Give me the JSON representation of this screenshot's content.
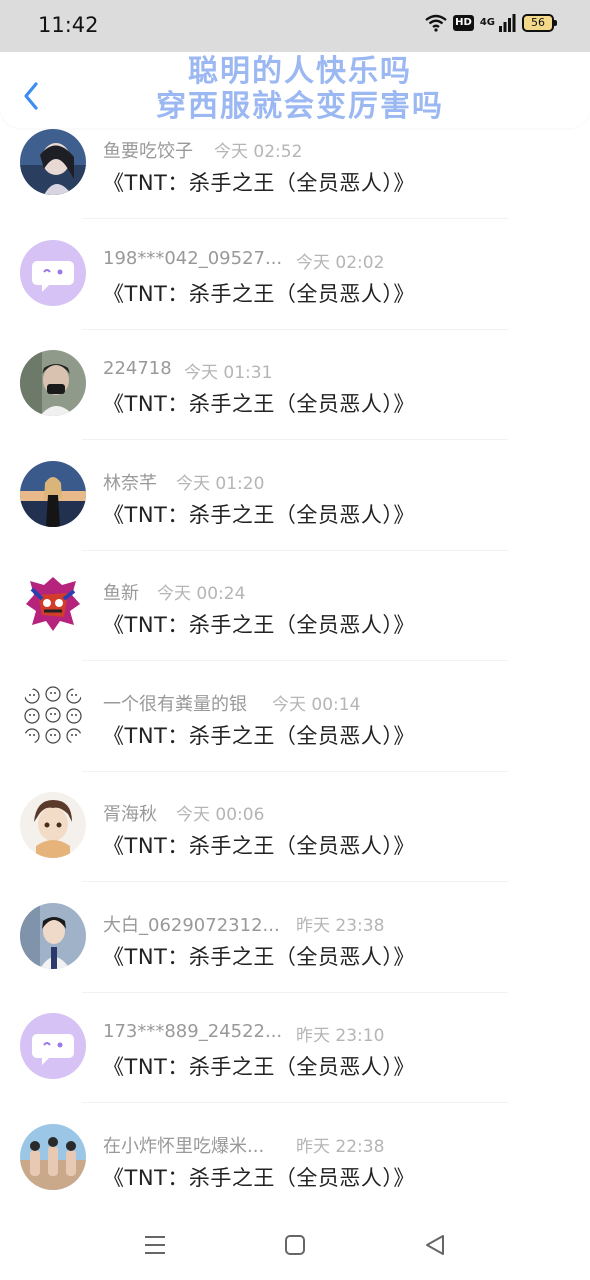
{
  "status_bar": {
    "time": "11:42",
    "hd": "HD",
    "network": "4G",
    "battery": "56",
    "icons": [
      "wifi-icon",
      "hd-icon",
      "signal-icon",
      "battery-icon"
    ]
  },
  "header": {
    "back_icon": "chevron-left-icon",
    "title_line1": "聪明的人快乐吗",
    "title_line2": "穿西服就会变厉害吗",
    "title_color": "#9bb8f2",
    "back_color": "#3d8ef0"
  },
  "rows": [
    {
      "name": "鱼要吃饺子",
      "time": "今天 02:52",
      "message": "《TNT：杀手之王（全员恶人）》",
      "avatar": "photo-avatar"
    },
    {
      "name": "198***042_09527...",
      "time": "今天 02:02",
      "message": "《TNT：杀手之王（全员恶人）》",
      "avatar": "default-chat-avatar"
    },
    {
      "name": "224718",
      "time": "今天 01:31",
      "message": "《TNT：杀手之王（全员恶人）》",
      "avatar": "photo-avatar"
    },
    {
      "name": "林奈芊",
      "time": "今天 01:20",
      "message": "《TNT：杀手之王（全员恶人）》",
      "avatar": "photo-avatar"
    },
    {
      "name": "鱼新",
      "time": "今天 00:24",
      "message": "《TNT：杀手之王（全员恶人）》",
      "avatar": "sticker-avatar"
    },
    {
      "name": "一个很有粪量的银",
      "time": "今天 00:14",
      "message": "《TNT：杀手之王（全员恶人）》",
      "avatar": "doodle-avatar"
    },
    {
      "name": "胥海秋",
      "time": "今天 00:06",
      "message": "《TNT：杀手之王（全员恶人）》",
      "avatar": "anime-avatar"
    },
    {
      "name": "大白_0629072312...",
      "time": "昨天 23:38",
      "message": "《TNT：杀手之王（全员恶人）》",
      "avatar": "photo-avatar"
    },
    {
      "name": "173***889_24522...",
      "time": "昨天 23:10",
      "message": "《TNT：杀手之王（全员恶人）》",
      "avatar": "default-chat-avatar"
    },
    {
      "name": "在小炸怀里吃爆米...",
      "time": "昨天 22:38",
      "message": "《TNT：杀手之王（全员恶人）》",
      "avatar": "photo-avatar"
    }
  ],
  "nav_bar": {
    "icons": [
      "menu-icon",
      "home-square-icon",
      "back-triangle-icon"
    ]
  }
}
